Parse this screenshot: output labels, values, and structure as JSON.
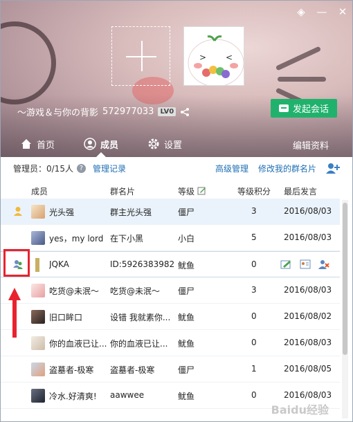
{
  "group": {
    "name": "～游戏＆与你の背影",
    "number": "572977033",
    "level_badge": "LV0",
    "start_chat_label": "发起会话"
  },
  "tabs": [
    {
      "label": "首页",
      "icon": "home-icon"
    },
    {
      "label": "成员",
      "icon": "member-icon"
    },
    {
      "label": "设置",
      "icon": "gear-icon"
    }
  ],
  "edit_profile_label": "编辑资料",
  "toolbar": {
    "admin_count": "管理员：0/15人",
    "admin_log": "管理记录",
    "advanced_manage": "高级管理",
    "modify_card": "修改我的群名片"
  },
  "table": {
    "headers": [
      "成员",
      "群名片",
      "等级",
      "等级积分",
      "最后发言"
    ],
    "rows": [
      {
        "nick": "光头强",
        "card": "群主光头强",
        "level": "僵尸",
        "score": "3",
        "date": "2016/08/03"
      },
      {
        "nick": "yes，my lord",
        "card": "在下小黑",
        "level": "小白",
        "score": "5",
        "date": "2016/08/03"
      },
      {
        "nick": "JQKA",
        "card": "ID:5926383982",
        "level": "鱿鱼",
        "score": "0",
        "date": ""
      },
      {
        "nick": "吃货@未泯～",
        "card": "吃货@未泯～",
        "level": "僵尸",
        "score": "3",
        "date": "2016/08/03"
      },
      {
        "nick": "旧口眸口",
        "card": "设错 我就素你...",
        "level": "鱿鱼",
        "score": "0",
        "date": "2016/08/02"
      },
      {
        "nick": "你的血液已让...",
        "card": "你的血液已让...",
        "level": "鱿鱼",
        "score": "0",
        "date": "2016/08/03"
      },
      {
        "nick": "盗墓者-极寒",
        "card": "盗墓者-极寒",
        "level": "僵尸",
        "score": "1",
        "date": "2016/08/05"
      },
      {
        "nick": "冷水.好清爽!",
        "card": "aawwee",
        "level": "鱿鱼",
        "score": "0",
        "date": "2016/08/03"
      }
    ]
  },
  "watermark": "Baidu经验",
  "colors": {
    "accent_green": "#20b26c",
    "link_blue": "#1f6fb5",
    "highlight_red": "#e8232e"
  }
}
